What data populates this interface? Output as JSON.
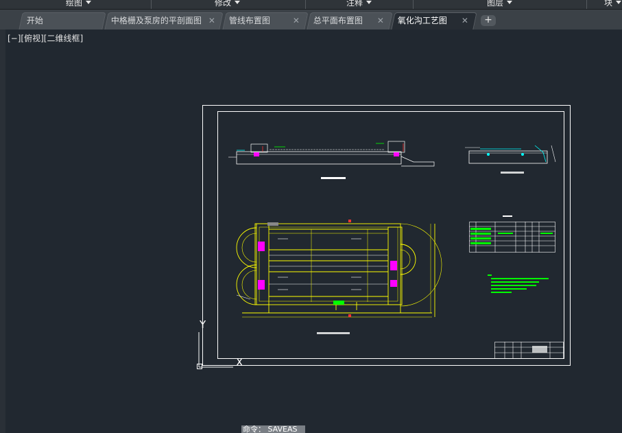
{
  "ribbon": {
    "panels": [
      {
        "label": "绘图"
      },
      {
        "label": "修改"
      },
      {
        "label": "注释"
      },
      {
        "label": "图层"
      },
      {
        "label": "块"
      }
    ]
  },
  "tabs": [
    {
      "label": "开始"
    },
    {
      "label": "中格栅及泵房的平剖面图"
    },
    {
      "label": "管线布置图"
    },
    {
      "label": "总平面布置图"
    },
    {
      "label": "氧化沟工艺图"
    }
  ],
  "tab_close_glyph": "✕",
  "tab_add_glyph": "+",
  "viewport": {
    "label": "[−][俯视][二维线框]"
  },
  "ucs": {
    "x_label": "X",
    "y_label": "Y"
  },
  "command": {
    "prompt": "命令：",
    "value": "SAVEAS"
  },
  "colors": {
    "background": "#212830",
    "frame": "#ffffff",
    "geometry": "#ffff00",
    "annotation": "#00ff00",
    "highlight": "#ff00ff",
    "cyan": "#00ffff",
    "red": "#ff3333"
  }
}
